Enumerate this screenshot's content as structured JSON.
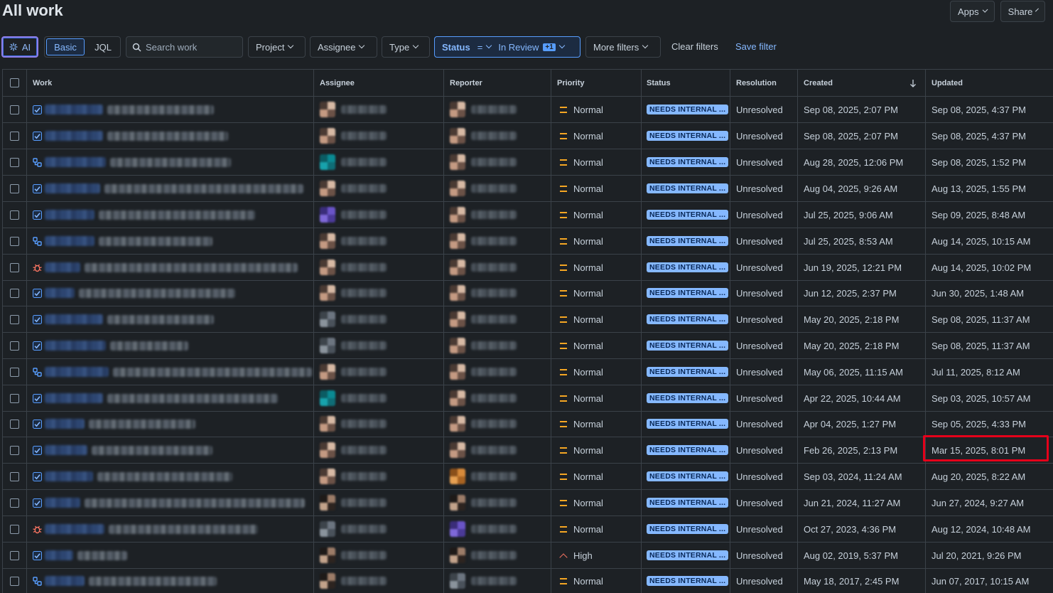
{
  "page": {
    "title": "All work"
  },
  "top_actions": {
    "apps": "Apps",
    "share": "Share"
  },
  "toolbar": {
    "ai": "AI",
    "basic": "Basic",
    "jql": "JQL",
    "search_placeholder": "Search work",
    "project": "Project",
    "assignee": "Assignee",
    "type": "Type",
    "status_label": "Status",
    "status_operator": "=",
    "status_value": "In Review",
    "status_extra": "+1",
    "more_filters": "More filters",
    "clear_filters": "Clear filters",
    "save_filter": "Save filter"
  },
  "columns": {
    "work": "Work",
    "assignee": "Assignee",
    "reporter": "Reporter",
    "priority": "Priority",
    "status": "Status",
    "resolution": "Resolution",
    "created": "Created",
    "updated": "Updated"
  },
  "sort": {
    "column": "created",
    "direction": "descending"
  },
  "rows": [
    {
      "type": "task",
      "priority": "Normal",
      "status": "NEEDS INTERNAL ...",
      "resolution": "Unresolved",
      "created": "Sep 08, 2025, 2:07 PM",
      "updated": "Sep 08, 2025, 4:37 PM",
      "assignee_avatar": "av-skin",
      "reporter_avatar": "av-skin"
    },
    {
      "type": "task",
      "priority": "Normal",
      "status": "NEEDS INTERNAL ...",
      "resolution": "Unresolved",
      "created": "Sep 08, 2025, 2:07 PM",
      "updated": "Sep 08, 2025, 4:37 PM",
      "assignee_avatar": "av-skin",
      "reporter_avatar": "av-skin"
    },
    {
      "type": "subtask",
      "priority": "Normal",
      "status": "NEEDS INTERNAL ...",
      "resolution": "Unresolved",
      "created": "Aug 28, 2025, 12:06 PM",
      "updated": "Sep 08, 2025, 1:52 PM",
      "assignee_avatar": "av-teal",
      "reporter_avatar": "av-skin"
    },
    {
      "type": "task",
      "priority": "Normal",
      "status": "NEEDS INTERNAL ...",
      "resolution": "Unresolved",
      "created": "Aug 04, 2025, 9:26 AM",
      "updated": "Aug 13, 2025, 1:55 PM",
      "assignee_avatar": "av-skin",
      "reporter_avatar": "av-skin"
    },
    {
      "type": "task",
      "priority": "Normal",
      "status": "NEEDS INTERNAL ...",
      "resolution": "Unresolved",
      "created": "Jul 25, 2025, 9:06 AM",
      "updated": "Sep 09, 2025, 8:48 AM",
      "assignee_avatar": "av-purple",
      "reporter_avatar": "av-skin"
    },
    {
      "type": "subtask",
      "priority": "Normal",
      "status": "NEEDS INTERNAL ...",
      "resolution": "Unresolved",
      "created": "Jul 25, 2025, 8:53 AM",
      "updated": "Aug 14, 2025, 10:15 AM",
      "assignee_avatar": "av-skin",
      "reporter_avatar": "av-skin"
    },
    {
      "type": "bug",
      "priority": "Normal",
      "status": "NEEDS INTERNAL ...",
      "resolution": "Unresolved",
      "created": "Jun 19, 2025, 12:21 PM",
      "updated": "Aug 14, 2025, 10:02 PM",
      "assignee_avatar": "av-skin",
      "reporter_avatar": "av-skin"
    },
    {
      "type": "task",
      "priority": "Normal",
      "status": "NEEDS INTERNAL ...",
      "resolution": "Unresolved",
      "created": "Jun 12, 2025, 2:37 PM",
      "updated": "Jun 30, 2025, 1:48 AM",
      "assignee_avatar": "av-skin",
      "reporter_avatar": "av-skin"
    },
    {
      "type": "task",
      "priority": "Normal",
      "status": "NEEDS INTERNAL ...",
      "resolution": "Unresolved",
      "created": "May 20, 2025, 2:18 PM",
      "updated": "Sep 08, 2025, 11:37 AM",
      "assignee_avatar": "av-grey",
      "reporter_avatar": "av-skin"
    },
    {
      "type": "task",
      "priority": "Normal",
      "status": "NEEDS INTERNAL ...",
      "resolution": "Unresolved",
      "created": "May 20, 2025, 2:18 PM",
      "updated": "Sep 08, 2025, 11:37 AM",
      "assignee_avatar": "av-grey",
      "reporter_avatar": "av-skin"
    },
    {
      "type": "subtask",
      "priority": "Normal",
      "status": "NEEDS INTERNAL ...",
      "resolution": "Unresolved",
      "created": "May 06, 2025, 11:15 AM",
      "updated": "Jul 11, 2025, 8:12 AM",
      "assignee_avatar": "av-skin",
      "reporter_avatar": "av-skin"
    },
    {
      "type": "task",
      "priority": "Normal",
      "status": "NEEDS INTERNAL ...",
      "resolution": "Unresolved",
      "created": "Apr 22, 2025, 10:44 AM",
      "updated": "Sep 03, 2025, 10:57 AM",
      "assignee_avatar": "av-teal",
      "reporter_avatar": "av-skin"
    },
    {
      "type": "task",
      "priority": "Normal",
      "status": "NEEDS INTERNAL ...",
      "resolution": "Unresolved",
      "created": "Apr 04, 2025, 1:27 PM",
      "updated": "Sep 05, 2025, 4:33 PM",
      "assignee_avatar": "av-skin",
      "reporter_avatar": "av-skin"
    },
    {
      "type": "task",
      "priority": "Normal",
      "status": "NEEDS INTERNAL ...",
      "resolution": "Unresolved",
      "created": "Feb 26, 2025, 2:13 PM",
      "updated": "Mar 15, 2025, 8:01 PM",
      "assignee_avatar": "av-skin",
      "reporter_avatar": "av-skin",
      "highlighted": true
    },
    {
      "type": "task",
      "priority": "Normal",
      "status": "NEEDS INTERNAL ...",
      "resolution": "Unresolved",
      "created": "Sep 03, 2024, 11:24 AM",
      "updated": "Aug 20, 2025, 8:22 AM",
      "assignee_avatar": "av-skin",
      "reporter_avatar": "av-orange"
    },
    {
      "type": "task",
      "priority": "Normal",
      "status": "NEEDS INTERNAL ...",
      "resolution": "Unresolved",
      "created": "Jun 21, 2024, 11:27 AM",
      "updated": "Jun 27, 2024, 9:27 AM",
      "assignee_avatar": "av-dark",
      "reporter_avatar": "av-dark"
    },
    {
      "type": "bug",
      "priority": "Normal",
      "status": "NEEDS INTERNAL ...",
      "resolution": "Unresolved",
      "created": "Oct 27, 2023, 4:36 PM",
      "updated": "Aug 12, 2024, 10:48 AM",
      "assignee_avatar": "av-grey",
      "reporter_avatar": "av-purple"
    },
    {
      "type": "task",
      "priority": "High",
      "status": "NEEDS INTERNAL ...",
      "resolution": "Unresolved",
      "created": "Aug 02, 2019, 5:37 PM",
      "updated": "Jul 20, 2021, 9:26 PM",
      "assignee_avatar": "av-dark",
      "reporter_avatar": "av-dark"
    },
    {
      "type": "subtask",
      "priority": "Normal",
      "status": "NEEDS INTERNAL ...",
      "resolution": "Unresolved",
      "created": "May 18, 2017, 2:45 PM",
      "updated": "Jun 07, 2017, 10:15 AM",
      "assignee_avatar": "av-dark",
      "reporter_avatar": "av-grey"
    }
  ],
  "colors": {
    "background": "#1d2125",
    "accent": "#579dff",
    "lozenge_bg": "#85b8ff",
    "priority_normal": "#f5a623",
    "priority_high": "#f87462",
    "highlight": "#e5001a"
  }
}
